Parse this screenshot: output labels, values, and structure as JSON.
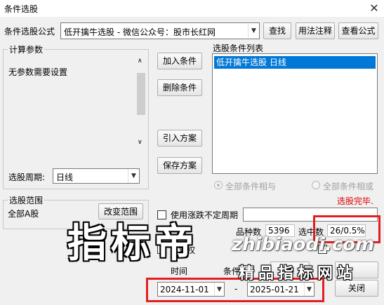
{
  "window": {
    "title": "条件选股"
  },
  "formula": {
    "label": "条件选股公式",
    "value": "低开擒牛选股  -  微信公众号：股市长红网",
    "find_button": "查找",
    "usage_button": "用法注释",
    "view_button": "查看公式"
  },
  "params": {
    "legend": "计算参数",
    "text": "无参数需要设置",
    "period_label": "选股周期:",
    "period_value": "日线"
  },
  "actions": {
    "add": "加入条件",
    "delete": "删除条件",
    "import": "引入方案",
    "save": "保存方案"
  },
  "conditions": {
    "label": "选股条件列表",
    "items": [
      "低开擒牛选股  日线"
    ],
    "radio_and": "全部条件相与",
    "radio_or": "全部条件相或",
    "status": "选股完毕."
  },
  "range": {
    "legend": "选股范围",
    "value": "全部A股",
    "change_button": "改变范围"
  },
  "options": {
    "use_undetermined": "使用涨跌不定周期",
    "varieties_label": "品种数",
    "varieties_value": "5396",
    "selected_label": "选中数",
    "selected_value": "26/0.5%",
    "prev_adjust": "前复权",
    "condition_frag": "条件",
    "time_frag": "时间",
    "select_frag": "选"
  },
  "dates": {
    "start": "2024-11-01",
    "separator": "-",
    "end": "2025-01-21",
    "close_button": "关闭"
  },
  "watermark": {
    "big": "指标帝",
    "small": "精品指标网站",
    "url": "zhibiaodi.com"
  },
  "colors": {
    "selection": "#0078d7",
    "highlight_box": "#e02020",
    "status_red": "#e00000"
  }
}
